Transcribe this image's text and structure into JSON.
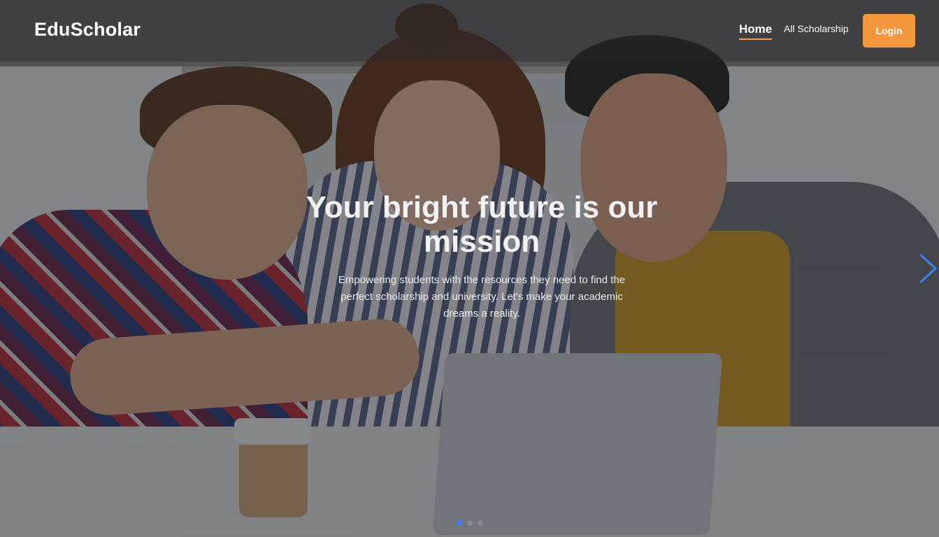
{
  "brand": {
    "name": "EduScholar"
  },
  "nav": {
    "items": [
      {
        "label": "Home",
        "active": true
      },
      {
        "label": "All Scholarship",
        "active": false
      }
    ],
    "login_label": "Login"
  },
  "hero": {
    "title": "Your bright future is our mission",
    "subtitle": "Empowering students with the resources they need to find the perfect scholarship and university. Let's make your academic dreams a reality."
  },
  "carousel": {
    "next_icon": "chevron-right-icon",
    "slides_count": 3,
    "active_index": 0
  },
  "colors": {
    "accent": "#f4973d",
    "active_dot": "#3b82f6",
    "arrow": "#3b82f6"
  }
}
